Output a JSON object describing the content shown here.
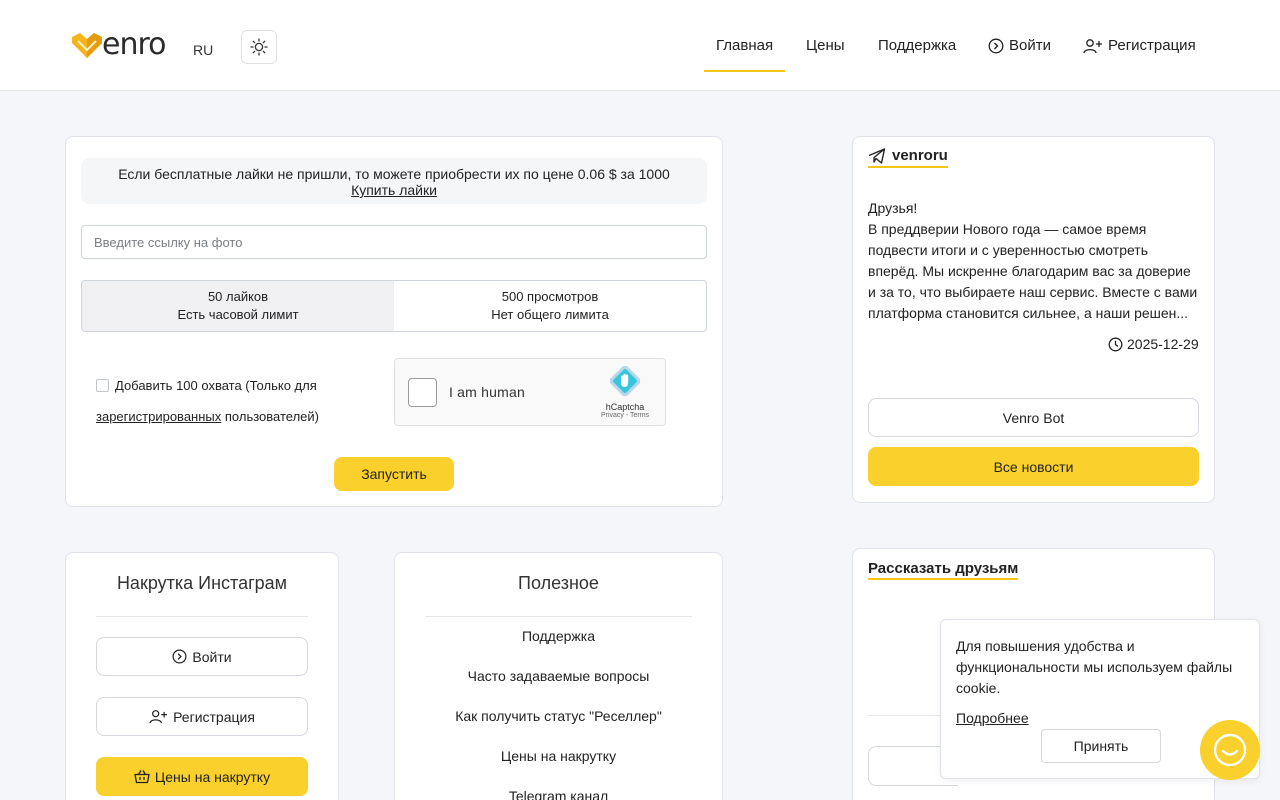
{
  "header": {
    "logo_text": "enro",
    "lang": "RU",
    "nav": [
      {
        "label": "Главная",
        "active": true
      },
      {
        "label": "Цены"
      },
      {
        "label": "Поддержка"
      },
      {
        "label": "Войти",
        "icon": "login-icon"
      },
      {
        "label": "Регистрация",
        "icon": "user-plus-icon"
      }
    ]
  },
  "form": {
    "notice_text": "Если бесплатные лайки не пришли, то можете приобрести их по цене 0.06 $ за 1000",
    "notice_link": "Купить лайки",
    "photo_input_placeholder": "Введите ссылку на фото",
    "options": [
      {
        "line1": "50 лайков",
        "line2": "Есть часовой лимит",
        "selected": true
      },
      {
        "line1": "500 просмотров",
        "line2": "Нет общего лимита",
        "selected": false
      }
    ],
    "reach_prefix": "Добавить 100 охвата (Только для",
    "reach_link": "зарегистрированных",
    "reach_suffix": " пользователей)",
    "captcha_label": "I am human",
    "captcha_brand": "hCaptcha",
    "captcha_links": "Privacy - Terms",
    "submit_label": "Запустить"
  },
  "news": {
    "channel": "venroru",
    "lines": [
      "Друзья!",
      "В преддверии Нового года — самое время",
      "подвести итоги и с уверенностью смотреть",
      "вперёд. Мы искренне благодарим вас за доверие",
      "и за то, что выбираете наш сервис. Вместе с вами",
      "платформа становится сильнее, а наши решен..."
    ],
    "date": "2025-12-29",
    "bot_button": "Venro Bot",
    "all_news_button": "Все новости"
  },
  "instagram": {
    "title": "Накрутка Инстаграм",
    "login": "Войти",
    "register": "Регистрация",
    "prices": "Цены на накрутку"
  },
  "useful": {
    "title": "Полезное",
    "links": [
      "Поддержка",
      "Часто задаваемые вопросы",
      "Как получить статус \"Реселлер\"",
      "Цены на накрутку",
      "Telegram канал"
    ]
  },
  "share": {
    "title": "Рассказать друзьям"
  },
  "cookie": {
    "text": "Для повышения удобства и функциональности мы используем файлы cookie.",
    "more": "Подробнее",
    "accept": "Принять"
  },
  "colors": {
    "accent": "#fad02c",
    "underline": "#f5c518",
    "page_bg": "#f5f6fa"
  }
}
